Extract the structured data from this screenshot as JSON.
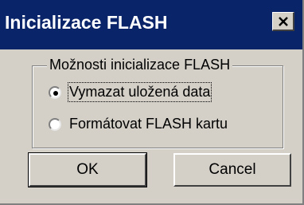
{
  "window": {
    "title": "Inicializace FLASH"
  },
  "titlebar": {
    "close_icon": "close-icon"
  },
  "group": {
    "legend": "Možnosti inicializace FLASH",
    "options": [
      {
        "label": "Vymazat uložená data",
        "checked": true
      },
      {
        "label": "Formátovat FLASH kartu",
        "checked": false
      }
    ]
  },
  "buttons": {
    "ok": "OK",
    "cancel": "Cancel"
  },
  "colors": {
    "titlebar": "#0a246a",
    "face": "#d4d0c8"
  }
}
